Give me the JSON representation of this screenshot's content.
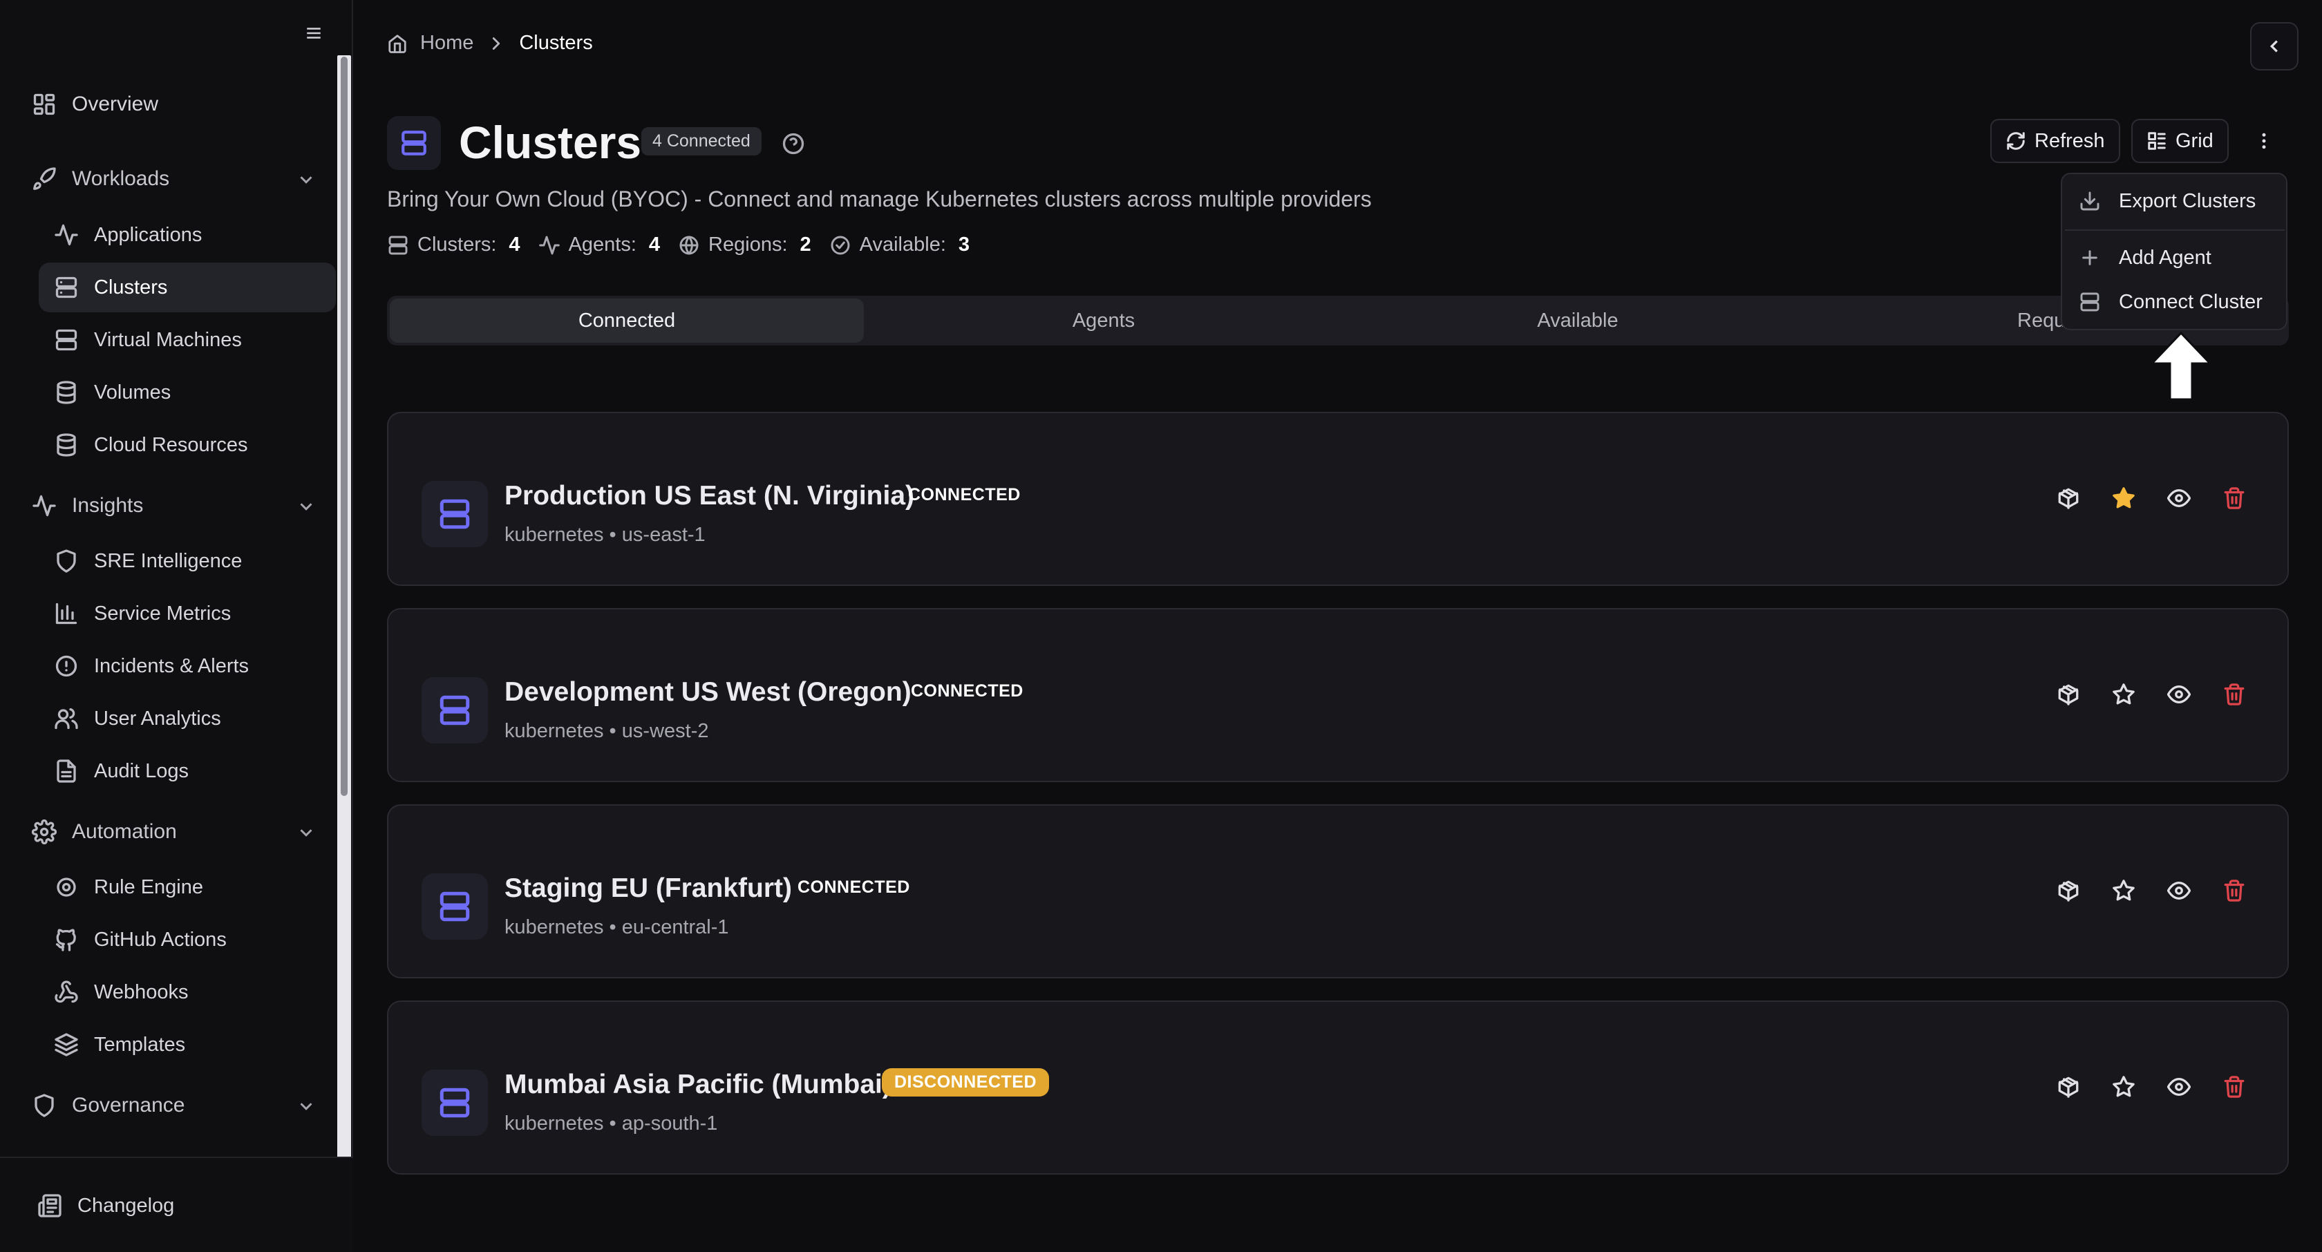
{
  "sidebar": {
    "overview": "Overview",
    "groups": {
      "workloads": "Workloads",
      "insights": "Insights",
      "automation": "Automation",
      "governance": "Governance"
    },
    "workloads": [
      "Applications",
      "Clusters",
      "Virtual Machines",
      "Volumes",
      "Cloud Resources"
    ],
    "insights": [
      "SRE Intelligence",
      "Service Metrics",
      "Incidents & Alerts",
      "User Analytics",
      "Audit Logs"
    ],
    "automation": [
      "Rule Engine",
      "GitHub Actions",
      "Webhooks",
      "Templates"
    ],
    "active_item": "Clusters",
    "footer": "Changelog"
  },
  "breadcrumb": {
    "home": "Home",
    "current": "Clusters"
  },
  "header": {
    "title": "Clusters",
    "badge": "4 Connected",
    "subtitle": "Bring Your Own Cloud (BYOC) - Connect and manage Kubernetes clusters across multiple providers",
    "stats": {
      "clusters_label": "Clusters:",
      "clusters_value": "4",
      "agents_label": "Agents:",
      "agents_value": "4",
      "regions_label": "Regions:",
      "regions_value": "2",
      "available_label": "Available:",
      "available_value": "3"
    },
    "refresh_label": "Refresh",
    "view_label": "Grid"
  },
  "tabs": [
    "Connected",
    "Agents",
    "Available",
    "Reques"
  ],
  "active_tab": "Connected",
  "dropdown": {
    "export": "Export Clusters",
    "add_agent": "Add Agent",
    "connect_cluster": "Connect Cluster"
  },
  "clusters": [
    {
      "name": "Production US East (N. Virginia)",
      "status": "CONNECTED",
      "type": "kubernetes",
      "region": "us-east-1",
      "starred": true
    },
    {
      "name": "Development US West (Oregon)",
      "status": "CONNECTED",
      "type": "kubernetes",
      "region": "us-west-2",
      "starred": false
    },
    {
      "name": "Staging EU (Frankfurt)",
      "status": "CONNECTED",
      "type": "kubernetes",
      "region": "eu-central-1",
      "starred": false
    },
    {
      "name": "Mumbai Asia Pacific (Mumbai)",
      "status": "DISCONNECTED",
      "type": "kubernetes",
      "region": "ap-south-1",
      "starred": false
    }
  ],
  "colors": {
    "accent": "#6f6cf5",
    "warning": "#e3a72f",
    "danger": "#e0454b",
    "star": "#f5b83a"
  }
}
